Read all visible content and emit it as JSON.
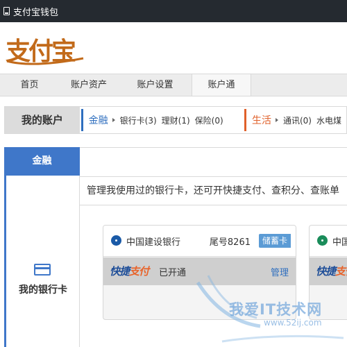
{
  "window": {
    "title": "支付宝钱包"
  },
  "logo": {
    "text": "支付宝"
  },
  "topnav": {
    "items": [
      {
        "label": "首页"
      },
      {
        "label": "账户资产"
      },
      {
        "label": "账户设置"
      },
      {
        "label": "账户通",
        "active": true
      }
    ]
  },
  "account_bar": {
    "title": "我的账户",
    "finance": {
      "title": "金融",
      "links": [
        "银行卡(3)",
        "理财(1)",
        "保险(0)"
      ]
    },
    "life": {
      "title": "生活",
      "links": [
        "通讯(0)",
        "水电煤"
      ]
    }
  },
  "sidebar": {
    "tab": "金融",
    "section_label": "我的银行卡",
    "icon": "bank-card-icon"
  },
  "content": {
    "description": "管理我使用过的银行卡，还可开快捷支付、查积分、查账单",
    "cards": [
      {
        "bank": "中国建设银行",
        "tail": "尾号8261",
        "type": "储蓄卡",
        "quick_logo_a": "快捷",
        "quick_logo_b": "支付",
        "status": "已开通",
        "manage": "管理"
      },
      {
        "bank": "中国",
        "quick_logo_a": "快捷",
        "quick_logo_b": "支付"
      }
    ]
  },
  "watermark": {
    "text": "我爱IT技术网",
    "url": "www.52ij.com"
  },
  "colors": {
    "titlebar": "#252a30",
    "blue": "#3f77c9",
    "orange": "#e0602a",
    "logo": "#c26a1a"
  }
}
